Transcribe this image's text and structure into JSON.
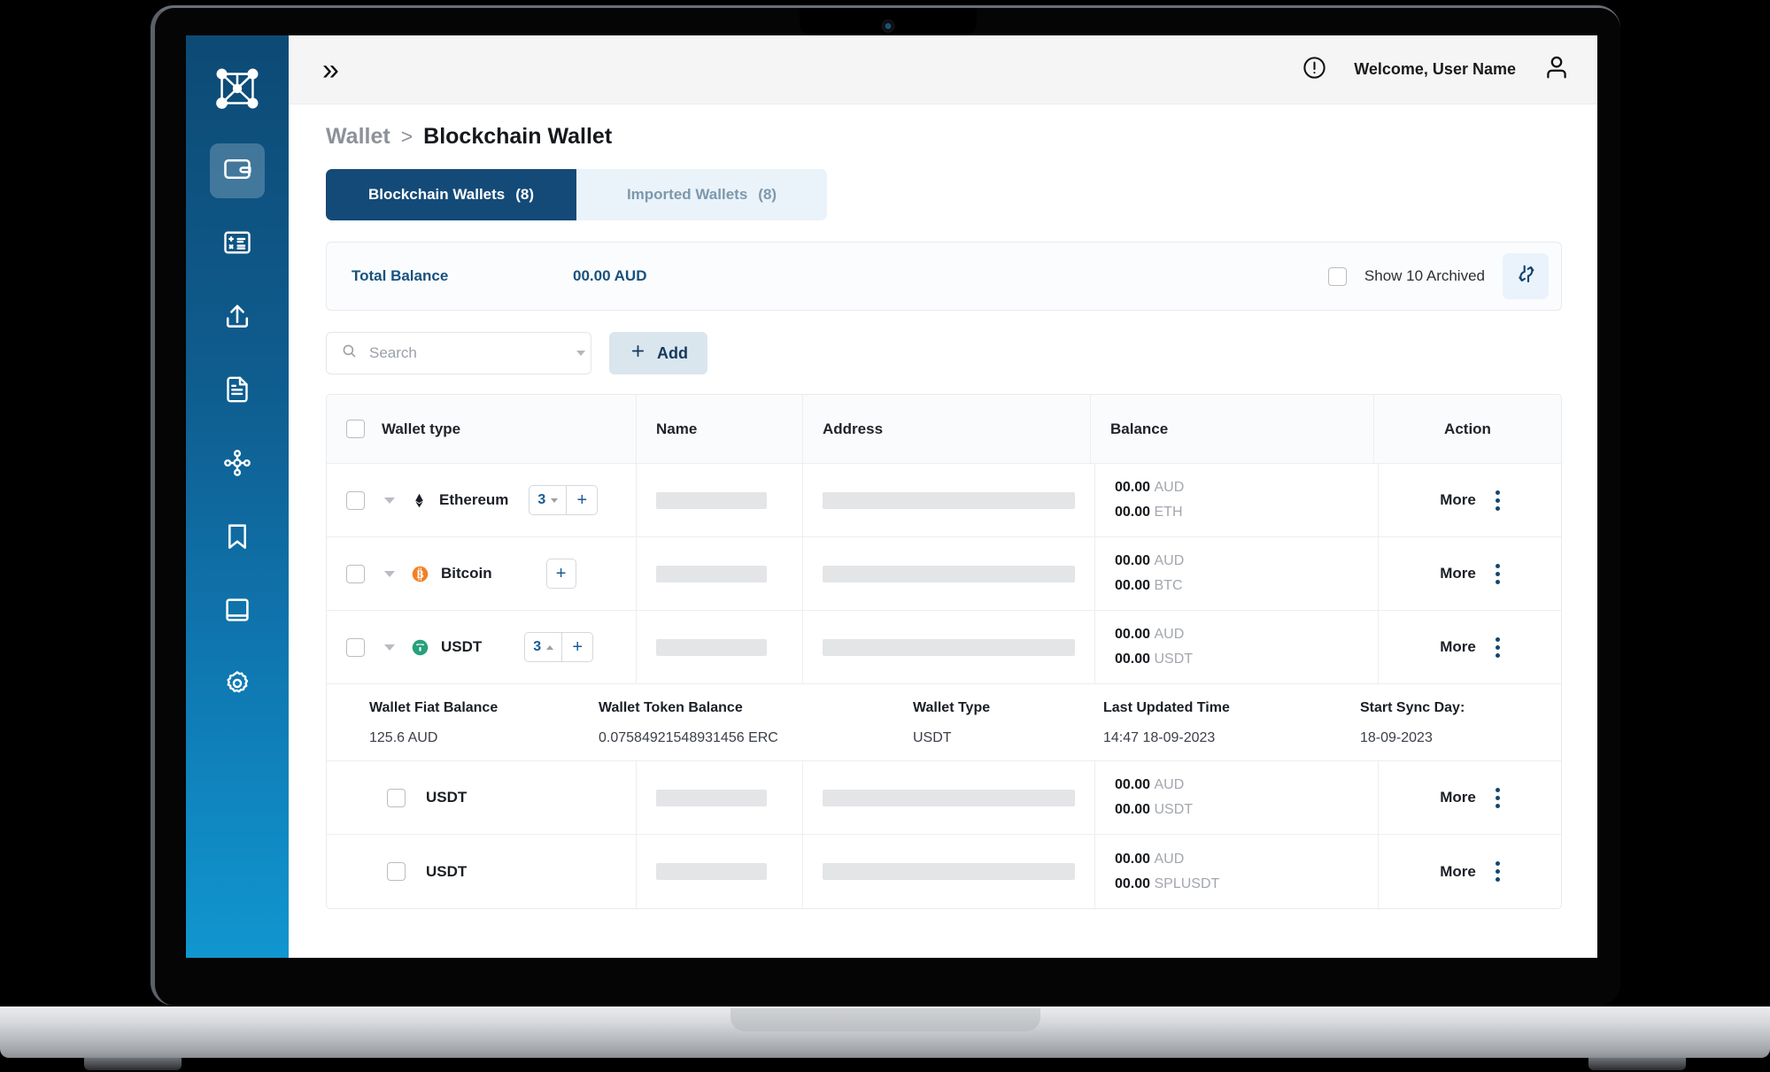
{
  "sidebar": {
    "brand_icon": "network-logo-icon",
    "items": [
      {
        "icon": "wallet-icon",
        "name": "sidebar-item-wallet",
        "active": true
      },
      {
        "icon": "calculator-icon",
        "name": "sidebar-item-calculator",
        "active": false
      },
      {
        "icon": "upload-icon",
        "name": "sidebar-item-upload",
        "active": false
      },
      {
        "icon": "document-icon",
        "name": "sidebar-item-documents",
        "active": false
      },
      {
        "icon": "node-share-icon",
        "name": "sidebar-item-network",
        "active": false
      },
      {
        "icon": "bookmark-icon",
        "name": "sidebar-item-bookmarks",
        "active": false
      },
      {
        "icon": "book-icon",
        "name": "sidebar-item-ledger",
        "active": false
      },
      {
        "icon": "gear-icon",
        "name": "sidebar-item-settings",
        "active": false
      }
    ]
  },
  "topbar": {
    "expand_icon": "double-chevron-right-icon",
    "alert_icon": "exclamation-circle-icon",
    "welcome": "Welcome, User Name",
    "avatar_icon": "person-icon"
  },
  "breadcrumb": {
    "parent": "Wallet",
    "separator": ">",
    "current": "Blockchain Wallet"
  },
  "tabs": [
    {
      "label": "Blockchain Wallets",
      "count": "(8)",
      "active": true
    },
    {
      "label": "Imported Wallets",
      "count": "(8)",
      "active": false
    }
  ],
  "balance_bar": {
    "label": "Total Balance",
    "value": "00.00 AUD",
    "archived_label": "Show 10 Archived",
    "archived_checked": false,
    "refresh_icon": "refresh-icon"
  },
  "toolbar": {
    "search_placeholder": "Search",
    "search_value": "",
    "search_icon": "search-icon",
    "dropdown_icon": "chevron-down-icon",
    "add_label": "Add",
    "add_icon": "plus-icon"
  },
  "table": {
    "headers": [
      "Wallet type",
      "Name",
      "Address",
      "Balance",
      "Action"
    ],
    "rows": [
      {
        "coin": "Ethereum",
        "coin_icon": "ethereum-icon",
        "coin_color": "#1b1f25",
        "stepper": {
          "count": "3",
          "direction": "down",
          "has_count": true
        },
        "balance_fiat": "00.00",
        "fiat_unit": "AUD",
        "balance_token": "00.00",
        "token_unit": "ETH",
        "action": "More"
      },
      {
        "coin": "Bitcoin",
        "coin_icon": "bitcoin-icon",
        "coin_color": "#f08026",
        "stepper": {
          "count": "",
          "direction": "",
          "has_count": false
        },
        "balance_fiat": "00.00",
        "fiat_unit": "AUD",
        "balance_token": "00.00",
        "token_unit": "BTC",
        "action": "More"
      },
      {
        "coin": "USDT",
        "coin_icon": "tether-icon",
        "coin_color": "#26a17b",
        "stepper": {
          "count": "3",
          "direction": "up",
          "has_count": true
        },
        "balance_fiat": "00.00",
        "fiat_unit": "AUD",
        "balance_token": "00.00",
        "token_unit": "USDT",
        "action": "More"
      }
    ],
    "detail": {
      "fields": [
        {
          "label": "Wallet Fiat Balance",
          "value": "125.6 AUD"
        },
        {
          "label": "Wallet Token Balance",
          "value": "0.07584921548931456 ERC"
        },
        {
          "label": "Wallet Type",
          "value": "USDT"
        },
        {
          "label": "Last Updated Time",
          "value": "14:47 18-09-2023"
        },
        {
          "label": "Start Sync Day:",
          "value": "18-09-2023"
        }
      ]
    },
    "subrows": [
      {
        "coin": "USDT",
        "balance_fiat": "00.00",
        "fiat_unit": "AUD",
        "balance_token": "00.00",
        "token_unit": "USDT",
        "action": "More"
      },
      {
        "coin": "USDT",
        "balance_fiat": "00.00",
        "fiat_unit": "AUD",
        "balance_token": "00.00",
        "token_unit": "SPLUSDT",
        "action": "More"
      }
    ]
  },
  "colors": {
    "sidebar_top": "#0d4a75",
    "sidebar_bottom": "#1196cf",
    "tab_active_bg": "#144a77",
    "tab_inactive_bg": "#eaf3f9",
    "accent_blue": "#17517e",
    "add_btn_bg": "#d9e6ee",
    "bitcoin_orange": "#f08026",
    "tether_green": "#26a17b"
  }
}
